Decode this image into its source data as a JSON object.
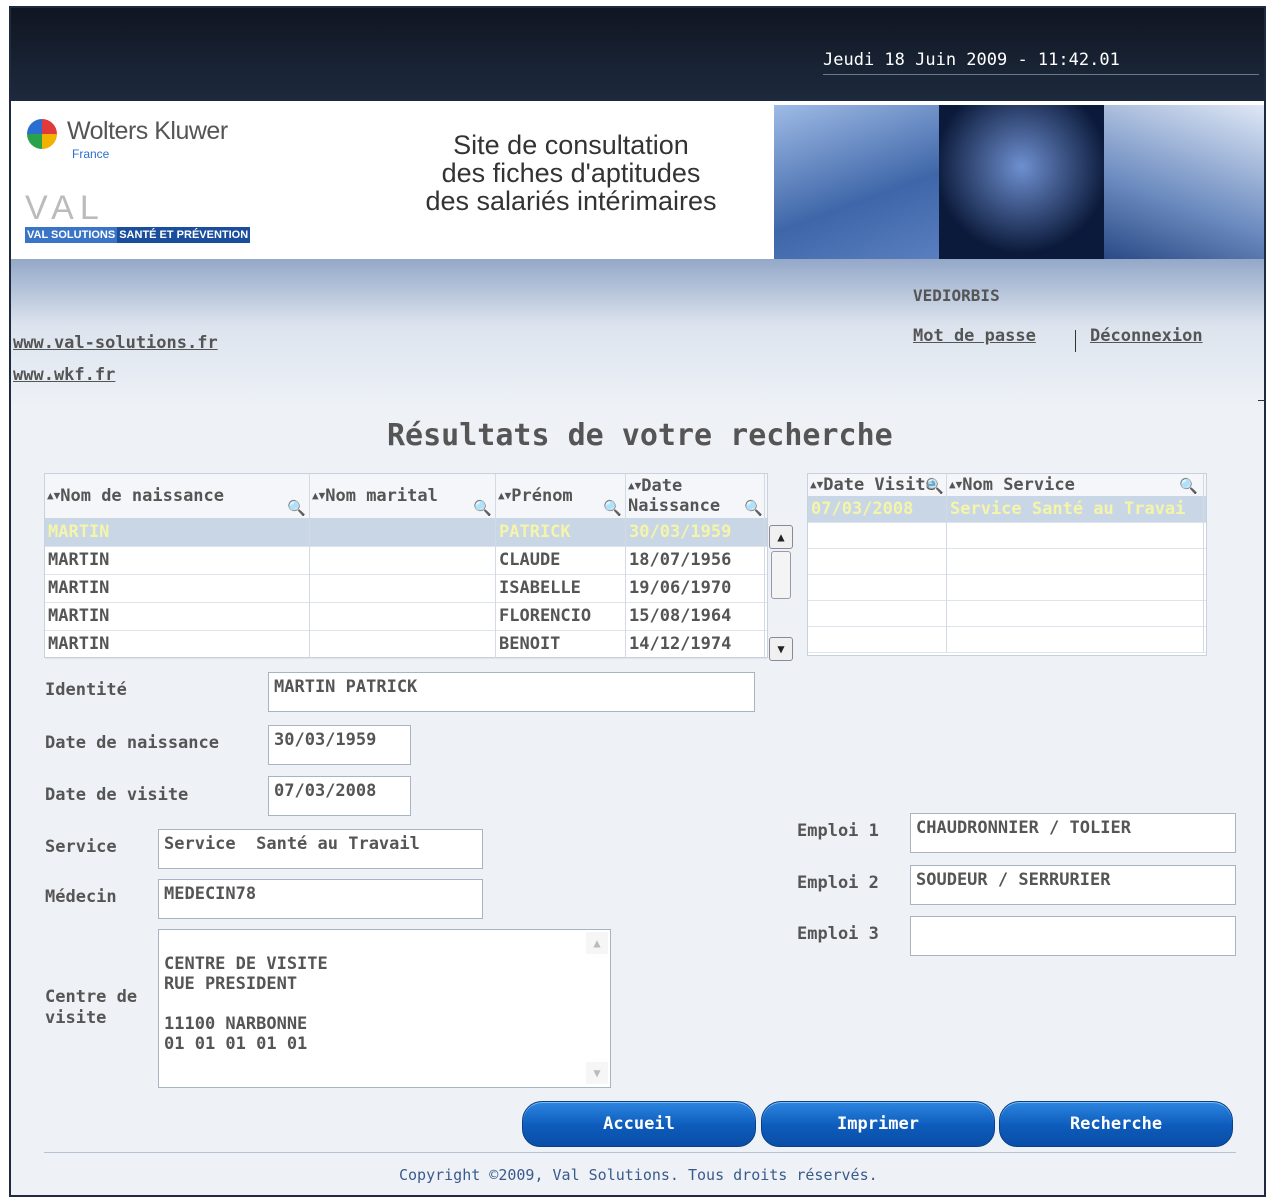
{
  "header": {
    "datetime": "Jeudi 18 Juin 2009 - 11:42.01"
  },
  "banner": {
    "logo_name": "Wolters Kluwer",
    "logo_sub": "France",
    "val_mark": "VAL",
    "val_strip_a": "VAL SOLUTIONS",
    "val_strip_b": "SANTÉ ET PRÉVENTION",
    "title_line1": "Site de consultation",
    "title_line2": "des fiches d'aptitudes",
    "title_line3": "des salariés intérimaires"
  },
  "nav": {
    "company": "VEDIORBIS",
    "password_link": "Mot de passe",
    "logout_link": "Déconnexion",
    "site_link1": "www.val-solutions.fr",
    "site_link2": "www.wkf.fr"
  },
  "page_title": "Résultats de votre recherche",
  "results_table": {
    "headers": [
      "Nom de naissance",
      "Nom marital",
      "Prénom",
      "Date Naissance"
    ],
    "rows": [
      [
        "MARTIN",
        "",
        "PATRICK",
        "30/03/1959"
      ],
      [
        "MARTIN",
        "",
        "CLAUDE",
        "18/07/1956"
      ],
      [
        "MARTIN",
        "",
        "ISABELLE",
        "19/06/1970"
      ],
      [
        "MARTIN",
        "",
        "FLORENCIO",
        "15/08/1964"
      ],
      [
        "MARTIN",
        "",
        "BENOIT",
        "14/12/1974"
      ]
    ]
  },
  "visits_table": {
    "headers": [
      "Date Visite",
      "Nom Service"
    ],
    "rows": [
      [
        "07/03/2008",
        "Service  Santé au Travai"
      ]
    ]
  },
  "form": {
    "identite_label": "Identité",
    "identite_value": "MARTIN PATRICK",
    "naissance_label": "Date de naissance",
    "naissance_value": "30/03/1959",
    "visite_label": "Date de visite",
    "visite_value": "07/03/2008",
    "service_label": "Service",
    "service_value": "Service  Santé au Travail",
    "medecin_label": "Médecin",
    "medecin_value": "MEDECIN78",
    "centre_label": "Centre de visite",
    "centre_value": "CENTRE DE VISITE\nRUE PRESIDENT\n\n11100 NARBONNE\n01 01 01 01 01",
    "emploi1_label": "Emploi 1",
    "emploi1_value": "CHAUDRONNIER / TOLIER",
    "emploi2_label": "Emploi 2",
    "emploi2_value": "SOUDEUR / SERRURIER",
    "emploi3_label": "Emploi 3",
    "emploi3_value": ""
  },
  "buttons": {
    "accueil": "Accueil",
    "imprimer": "Imprimer",
    "recherche": "Recherche"
  },
  "footer": {
    "copyright": "Copyright ©2009, Val Solutions. Tous droits réservés."
  }
}
